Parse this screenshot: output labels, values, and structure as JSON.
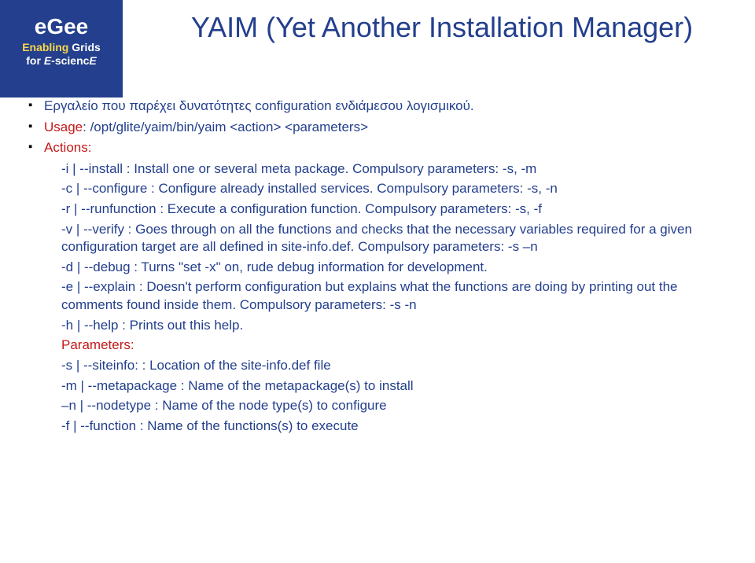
{
  "logo": {
    "brand": "eGee",
    "line1_p1": "Enabling",
    "line1_p2": " Grids",
    "line2_p1": "for ",
    "line2_p2": "E",
    "line2_p3": "-scienc",
    "line2_p4": "E"
  },
  "title": "YAIM (Yet Another Installation Manager)",
  "b1": "Εργαλείο που παρέχει δυνατότητες configuration ενδιάμεσου λογισμικού.",
  "b2_pre": "Usage",
  "b2_rest": ": /opt/glite/yaim/bin/yaim <action> <parameters>",
  "b3": "Actions:",
  "a_i": "-i | --install : Install one or several meta package. Compulsory parameters: -s, -m",
  "a_c": "-c | --configure : Configure already installed services. Compulsory parameters: -s, -n",
  "a_r": "-r | --runfunction : Execute a configuration function. Compulsory parameters: -s, -f",
  "a_v": "-v | --verify : Goes through on all the functions and checks that the necessary variables required for a given configuration target are all defined in site-info.def. Compulsory parameters: -s –n",
  "a_d": "-d | --debug : Turns \"set -x\" on, rude debug information for development.",
  "a_e": "-e | --explain : Doesn't perform configuration but explains what the functions are doing by printing out the comments found inside them. Compulsory parameters: -s -n",
  "a_h": "-h | --help : Prints out this help.",
  "params_label": "Parameters:",
  "p_s": "-s  | --siteinfo: : Location of the site-info.def file",
  "p_m": "-m | --metapackage : Name of the metapackage(s) to install",
  "p_n": "–n | --nodetype : Name of the node type(s) to configure",
  "p_f": "-f  | --function : Name of the functions(s) to execute"
}
